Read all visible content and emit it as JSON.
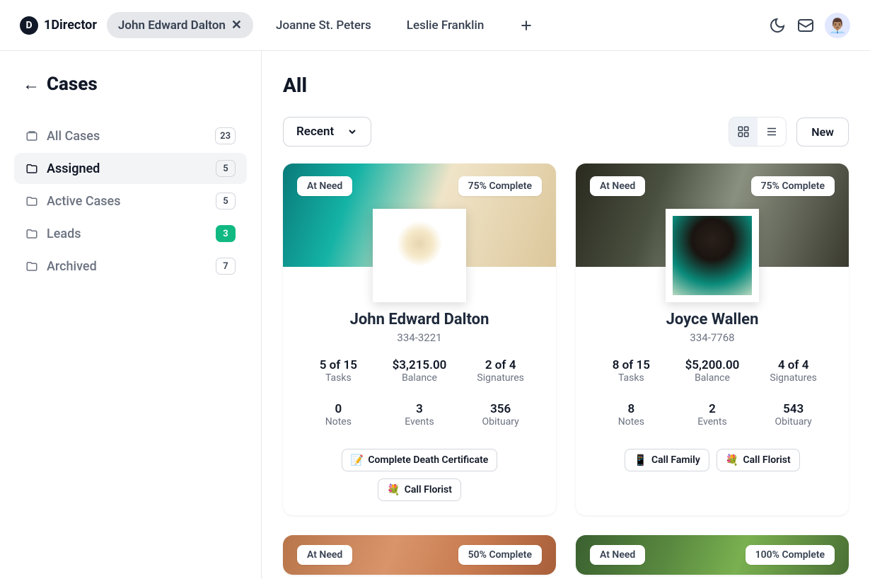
{
  "app": {
    "name": "1Director",
    "logo_letter": "D"
  },
  "header": {
    "tabs": [
      {
        "label": "John Edward Dalton",
        "active": true
      },
      {
        "label": "Joanne St. Peters",
        "active": false
      },
      {
        "label": "Leslie Franklin",
        "active": false
      }
    ],
    "avatar_emoji": "👨🏽‍💼"
  },
  "sidebar": {
    "title": "Cases",
    "items": [
      {
        "label": "All Cases",
        "count": "23",
        "active": false,
        "green": false
      },
      {
        "label": "Assigned",
        "count": "5",
        "active": true,
        "green": false
      },
      {
        "label": "Active Cases",
        "count": "5",
        "active": false,
        "green": false
      },
      {
        "label": "Leads",
        "count": "3",
        "active": false,
        "green": true
      },
      {
        "label": "Archived",
        "count": "7",
        "active": false,
        "green": false
      }
    ]
  },
  "main": {
    "title": "All",
    "sort_label": "Recent",
    "new_button": "New"
  },
  "cards": [
    {
      "status": "At Need",
      "progress": "75% Complete",
      "name": "John Edward Dalton",
      "phone": "334-3221",
      "stats": {
        "tasks_val": "5 of 15",
        "tasks_lab": "Tasks",
        "balance_val": "$3,215.00",
        "balance_lab": "Balance",
        "sigs_val": "2 of 4",
        "sigs_lab": "Signatures",
        "notes_val": "0",
        "notes_lab": "Notes",
        "events_val": "3",
        "events_lab": "Events",
        "obit_val": "356",
        "obit_lab": "Obituary"
      },
      "actions": [
        {
          "emoji": "📝",
          "label": "Complete Death Certificate"
        },
        {
          "emoji": "💐",
          "label": "Call Florist"
        }
      ]
    },
    {
      "status": "At Need",
      "progress": "75% Complete",
      "name": "Joyce Wallen",
      "phone": "334-7768",
      "stats": {
        "tasks_val": "8 of 15",
        "tasks_lab": "Tasks",
        "balance_val": "$5,200.00",
        "balance_lab": "Balance",
        "sigs_val": "4 of 4",
        "sigs_lab": "Signatures",
        "notes_val": "8",
        "notes_lab": "Notes",
        "events_val": "2",
        "events_lab": "Events",
        "obit_val": "543",
        "obit_lab": "Obituary"
      },
      "actions": [
        {
          "emoji": "📱",
          "label": "Call Family"
        },
        {
          "emoji": "💐",
          "label": "Call Florist"
        }
      ]
    }
  ],
  "peek_cards": [
    {
      "status": "At Need",
      "progress": "50% Complete"
    },
    {
      "status": "At Need",
      "progress": "100% Complete"
    }
  ]
}
